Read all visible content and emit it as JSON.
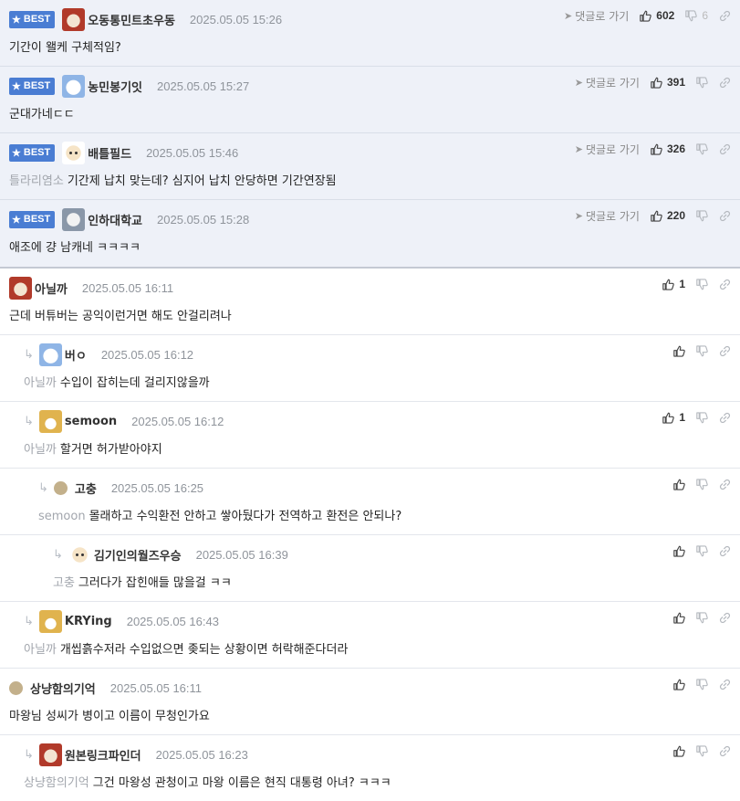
{
  "best_label": "BEST",
  "goto_label": "댓글로 가기",
  "best": [
    {
      "nick": "오동통민트초우동",
      "date": "2025.05.05 15:26",
      "ref": "",
      "text": "기간이 왤케 구체적임?",
      "up": "602",
      "down": "6",
      "avatar": "red"
    },
    {
      "nick": "농민봉기잇",
      "date": "2025.05.05 15:27",
      "ref": "",
      "text": "군대가네ㄷㄷ",
      "up": "391",
      "down": "",
      "avatar": "blue"
    },
    {
      "nick": "배틀필드",
      "date": "2025.05.05 15:46",
      "ref": "틀라리염소",
      "text": "기간제 납치 맞는데? 심지어 납치 안당하면 기간연장됨",
      "up": "326",
      "down": "",
      "avatar": "dog"
    },
    {
      "nick": "인하대학교",
      "date": "2025.05.05 15:28",
      "ref": "",
      "text": "애조에 걍 남캐네 ㅋㅋㅋㅋ",
      "up": "220",
      "down": "",
      "avatar": "grey"
    }
  ],
  "comments": [
    {
      "nick": "아닐까",
      "date": "2025.05.05 16:11",
      "ref": "",
      "text": "근데 버튜버는 공익이런거면 해도 안걸리려나",
      "up": "1",
      "indent": 0,
      "avatar": "red",
      "height": 73
    },
    {
      "nick": "버ㅇ",
      "date": "2025.05.05 16:12",
      "ref": "아닐까",
      "text": "수입이 잡히는데 걸리지않을까",
      "up": "",
      "indent": 1,
      "avatar": "blue",
      "height": 73
    },
    {
      "nick": "semoon",
      "date": "2025.05.05 16:12",
      "ref": "아닐까",
      "text": "할거면 허가받아야지",
      "up": "1",
      "indent": 1,
      "avatar": "fox",
      "height": 73
    },
    {
      "nick": "고충",
      "date": "2025.05.05 16:25",
      "ref": "semoon",
      "text": "몰래하고 수익환전 안하고 쌓아뒀다가 전역하고 환전은 안되나?",
      "up": "",
      "indent": 2,
      "avatar": "dot",
      "height": 73
    },
    {
      "nick": "김기인의월즈우승",
      "date": "2025.05.05 16:39",
      "ref": "고충",
      "text": "그러다가 잡힌애들 많을걸 ㅋㅋ",
      "up": "",
      "indent": 3,
      "avatar": "dog",
      "height": 73
    },
    {
      "nick": "KRYing",
      "date": "2025.05.05 16:43",
      "ref": "아닐까",
      "text": "개씹흙수저라 수입없으면 좆되는 상황이면 허락해준다더라",
      "up": "",
      "indent": 1,
      "avatar": "fox",
      "height": 73
    },
    {
      "nick": "상냥함의기억",
      "date": "2025.05.05 16:11",
      "ref": "",
      "text": "마왕님 성씨가 병이고 이름이 무청인가요",
      "up": "",
      "indent": 0,
      "avatar": "dot",
      "height": 73
    },
    {
      "nick": "원본링크파인더",
      "date": "2025.05.05 16:23",
      "ref": "상냥함의기억",
      "text": "그건 마왕성 관청이고 마왕 이름은 현직 대통령 아녀? ㅋㅋㅋ",
      "up": "",
      "indent": 1,
      "avatar": "red",
      "height": 73
    }
  ]
}
